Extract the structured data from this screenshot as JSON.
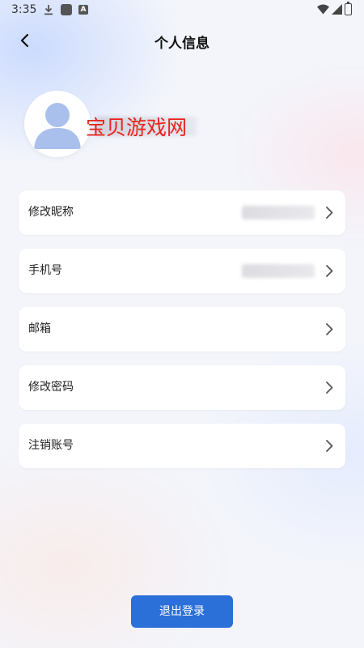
{
  "status_bar": {
    "time": "3:35",
    "a_icon_text": "A"
  },
  "header": {
    "title": "个人信息"
  },
  "profile": {
    "watermark": "宝贝游戏网"
  },
  "menu": {
    "items": [
      {
        "label": "修改昵称"
      },
      {
        "label": "手机号"
      },
      {
        "label": "邮箱"
      },
      {
        "label": "修改密码"
      },
      {
        "label": "注销账号"
      }
    ]
  },
  "logout": {
    "label": "退出登录"
  },
  "colors": {
    "accent": "#2b6fd9",
    "watermark": "#e8231c",
    "avatar": "#a9c0ec"
  },
  "icons": [
    "download-icon",
    "app-square-icon",
    "a-icon",
    "wifi-icon",
    "signal-icon",
    "battery-icon",
    "back-arrow-icon",
    "avatar-person-icon",
    "chevron-right-icon"
  ]
}
